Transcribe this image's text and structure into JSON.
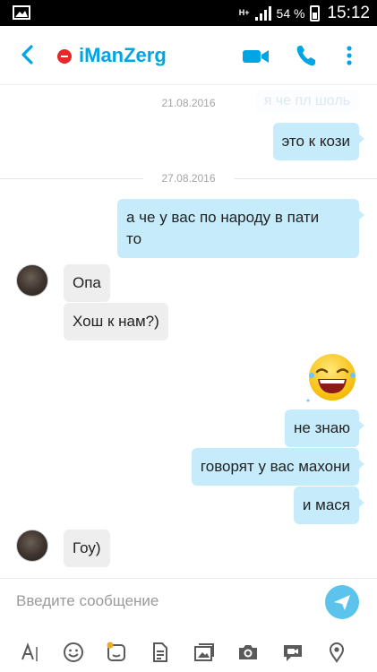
{
  "status_bar": {
    "network": "H+",
    "battery": "54 %",
    "time": "15:12"
  },
  "header": {
    "contact_name": "iManZerg"
  },
  "messages": {
    "date1": "21.08.2016",
    "faded_message": "я че пл шоль",
    "m1": "это к кози",
    "date2": "27.08.2016",
    "m2_line1": "а че у вас по народу в пати",
    "m2_line2": "то",
    "m3": "Опа",
    "m4": "Хош к нам?)",
    "m5": "не знаю",
    "m6": "говорят у вас махони",
    "m7": "и мася",
    "m8": "Гоу)"
  },
  "compose": {
    "placeholder": "Введите сообщение"
  },
  "colors": {
    "accent": "#00a5e6",
    "outgoing_bubble": "#c6ebfb",
    "incoming_bubble": "#eeeeee",
    "presence_busy": "#e8262b",
    "send_button": "#5cc4ec"
  },
  "icons": [
    "back-arrow-icon",
    "video-call-icon",
    "phone-icon",
    "more-icon",
    "text-format-icon",
    "emoticon-icon",
    "moji-icon",
    "file-icon",
    "media-gallery-icon",
    "camera-icon",
    "video-message-icon",
    "location-icon",
    "send-icon"
  ]
}
